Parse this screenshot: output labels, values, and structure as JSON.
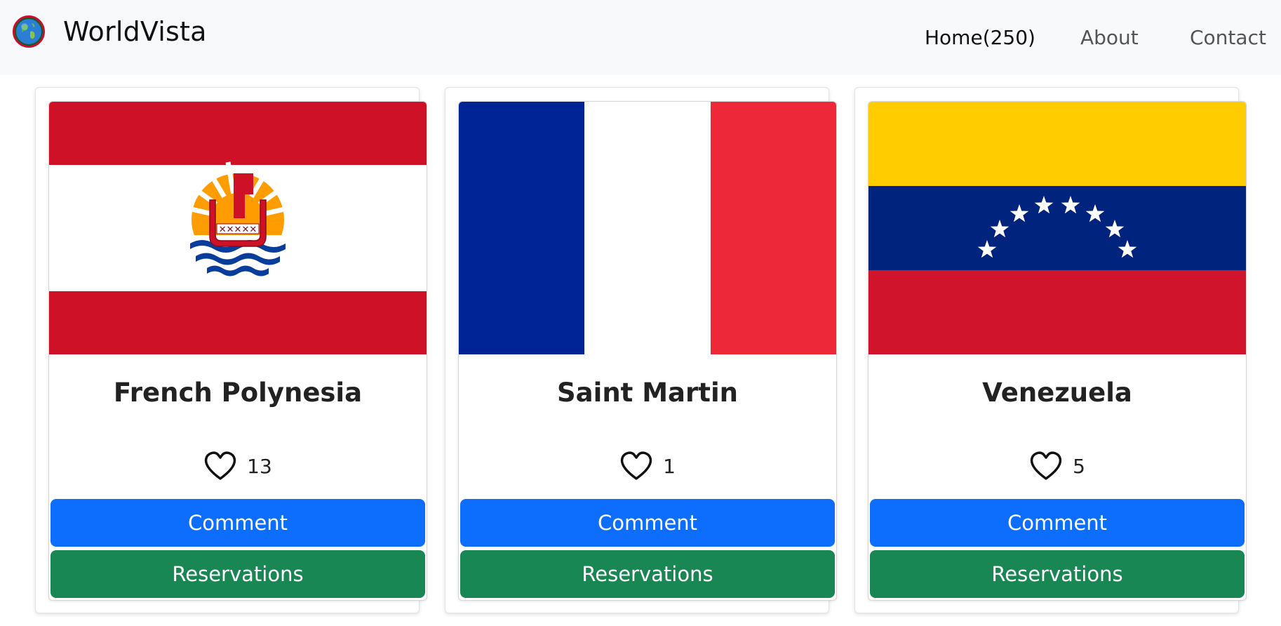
{
  "brand": {
    "name": "WorldVista",
    "logo_icon": "globe-icon"
  },
  "nav": {
    "home": "Home(250)",
    "about": "About",
    "contact": "Contact"
  },
  "cards": [
    {
      "country": "French Polynesia",
      "likes": "13",
      "comment_label": "Comment",
      "reservations_label": "Reservations",
      "flag": "french-polynesia-flag"
    },
    {
      "country": "Saint Martin",
      "likes": "1",
      "comment_label": "Comment",
      "reservations_label": "Reservations",
      "flag": "saint-martin-flag"
    },
    {
      "country": "Venezuela",
      "likes": "5",
      "comment_label": "Comment",
      "reservations_label": "Reservations",
      "flag": "venezuela-flag"
    }
  ],
  "colors": {
    "comment_button": "#0d6efd",
    "reservations_button": "#198754",
    "navbar_background": "#f8f9fa"
  }
}
